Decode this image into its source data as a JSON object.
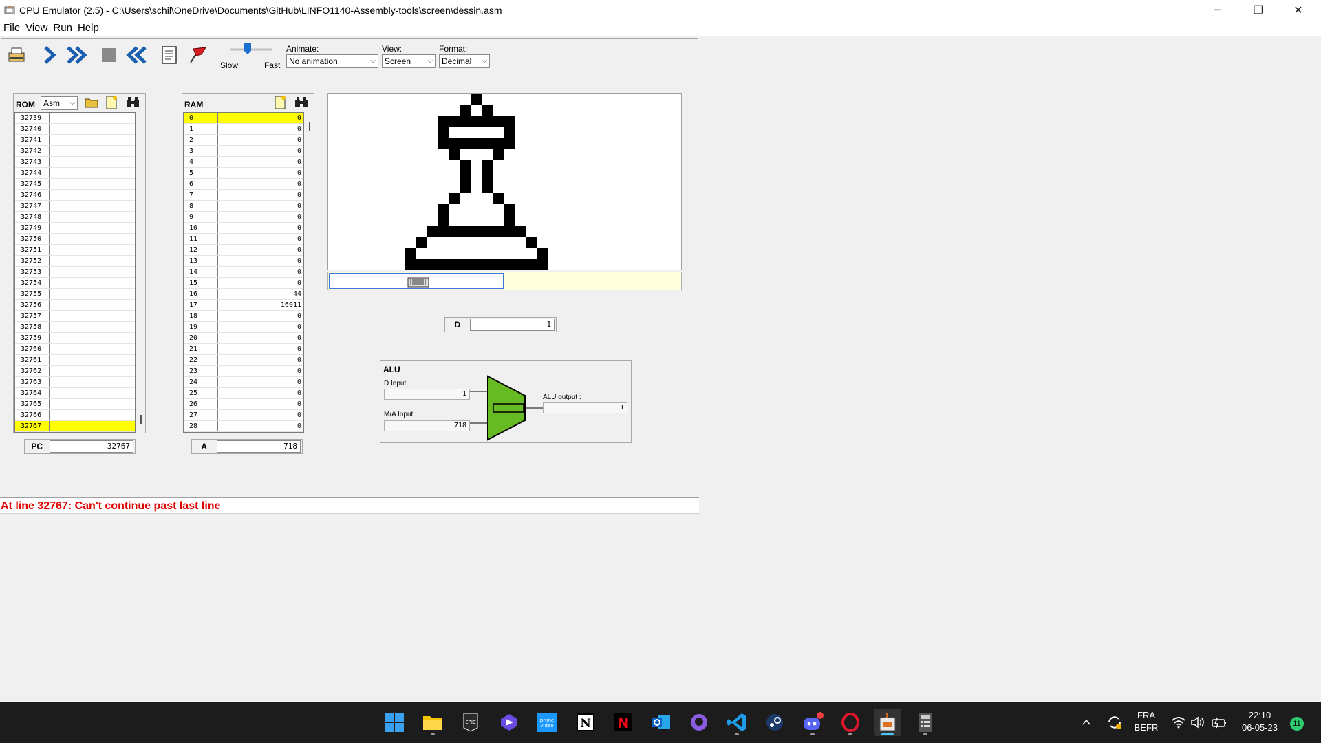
{
  "window": {
    "title": "CPU Emulator (2.5) - C:\\Users\\schil\\OneDrive\\Documents\\GitHub\\LINFO1140-Assembly-tools\\screen\\dessin.asm",
    "minimize": "─",
    "restore": "❐",
    "close": "✕"
  },
  "menu": {
    "file": "File",
    "view": "View",
    "run": "Run",
    "help": "Help"
  },
  "toolbar": {
    "speed_slow": "Slow",
    "speed_fast": "Fast",
    "animate_label": "Animate:",
    "animate_value": "No animation",
    "view_label": "View:",
    "view_value": "Screen",
    "format_label": "Format:",
    "format_value": "Decimal"
  },
  "rom": {
    "label": "ROM",
    "mode": "Asm",
    "rows": [
      {
        "addr": "32739",
        "val": ""
      },
      {
        "addr": "32740",
        "val": ""
      },
      {
        "addr": "32741",
        "val": ""
      },
      {
        "addr": "32742",
        "val": ""
      },
      {
        "addr": "32743",
        "val": ""
      },
      {
        "addr": "32744",
        "val": ""
      },
      {
        "addr": "32745",
        "val": ""
      },
      {
        "addr": "32746",
        "val": ""
      },
      {
        "addr": "32747",
        "val": ""
      },
      {
        "addr": "32748",
        "val": ""
      },
      {
        "addr": "32749",
        "val": ""
      },
      {
        "addr": "32750",
        "val": ""
      },
      {
        "addr": "32751",
        "val": ""
      },
      {
        "addr": "32752",
        "val": ""
      },
      {
        "addr": "32753",
        "val": ""
      },
      {
        "addr": "32754",
        "val": ""
      },
      {
        "addr": "32755",
        "val": ""
      },
      {
        "addr": "32756",
        "val": ""
      },
      {
        "addr": "32757",
        "val": ""
      },
      {
        "addr": "32758",
        "val": ""
      },
      {
        "addr": "32759",
        "val": ""
      },
      {
        "addr": "32760",
        "val": ""
      },
      {
        "addr": "32761",
        "val": ""
      },
      {
        "addr": "32762",
        "val": ""
      },
      {
        "addr": "32763",
        "val": ""
      },
      {
        "addr": "32764",
        "val": ""
      },
      {
        "addr": "32765",
        "val": ""
      },
      {
        "addr": "32766",
        "val": ""
      },
      {
        "addr": "32767",
        "val": ""
      }
    ],
    "highlight_addr": "32767"
  },
  "ram": {
    "label": "RAM",
    "rows": [
      {
        "addr": "0",
        "val": "0"
      },
      {
        "addr": "1",
        "val": "0"
      },
      {
        "addr": "2",
        "val": "0"
      },
      {
        "addr": "3",
        "val": "0"
      },
      {
        "addr": "4",
        "val": "0"
      },
      {
        "addr": "5",
        "val": "0"
      },
      {
        "addr": "6",
        "val": "0"
      },
      {
        "addr": "7",
        "val": "0"
      },
      {
        "addr": "8",
        "val": "0"
      },
      {
        "addr": "9",
        "val": "0"
      },
      {
        "addr": "10",
        "val": "0"
      },
      {
        "addr": "11",
        "val": "0"
      },
      {
        "addr": "12",
        "val": "0"
      },
      {
        "addr": "13",
        "val": "0"
      },
      {
        "addr": "14",
        "val": "0"
      },
      {
        "addr": "15",
        "val": "0"
      },
      {
        "addr": "16",
        "val": "44"
      },
      {
        "addr": "17",
        "val": "16911"
      },
      {
        "addr": "18",
        "val": "0"
      },
      {
        "addr": "19",
        "val": "0"
      },
      {
        "addr": "20",
        "val": "0"
      },
      {
        "addr": "21",
        "val": "0"
      },
      {
        "addr": "22",
        "val": "0"
      },
      {
        "addr": "23",
        "val": "0"
      },
      {
        "addr": "24",
        "val": "0"
      },
      {
        "addr": "25",
        "val": "0"
      },
      {
        "addr": "26",
        "val": "0"
      },
      {
        "addr": "27",
        "val": "0"
      },
      {
        "addr": "28",
        "val": "0"
      }
    ],
    "highlight_addr": "0"
  },
  "registers": {
    "pc_label": "PC",
    "pc_value": "32767",
    "a_label": "A",
    "a_value": "718",
    "d_label": "D",
    "d_value": "1"
  },
  "alu": {
    "title": "ALU",
    "d_input_label": "D Input :",
    "d_input_value": "1",
    "ma_input_label": "M/A Input :",
    "ma_input_value": "718",
    "output_label": "ALU output :",
    "output_value": "1",
    "color": "#66bb22"
  },
  "status": {
    "message": "At line 32767: Can't continue past last line",
    "color": "#e00000"
  },
  "taskbar": {
    "apps": [
      "windows-start-icon",
      "file-explorer-icon",
      "epic-games-icon",
      "copilot-icon",
      "prime-video-icon",
      "notion-icon",
      "netflix-icon",
      "outlook-icon",
      "github-icon",
      "vscode-icon",
      "steam-icon",
      "discord-icon",
      "opera-icon",
      "java-icon",
      "calculator-icon"
    ],
    "lang_top": "FRA",
    "lang_bottom": "BEFR",
    "time": "22:10",
    "date": "06-05-23",
    "notif_count": "11"
  }
}
